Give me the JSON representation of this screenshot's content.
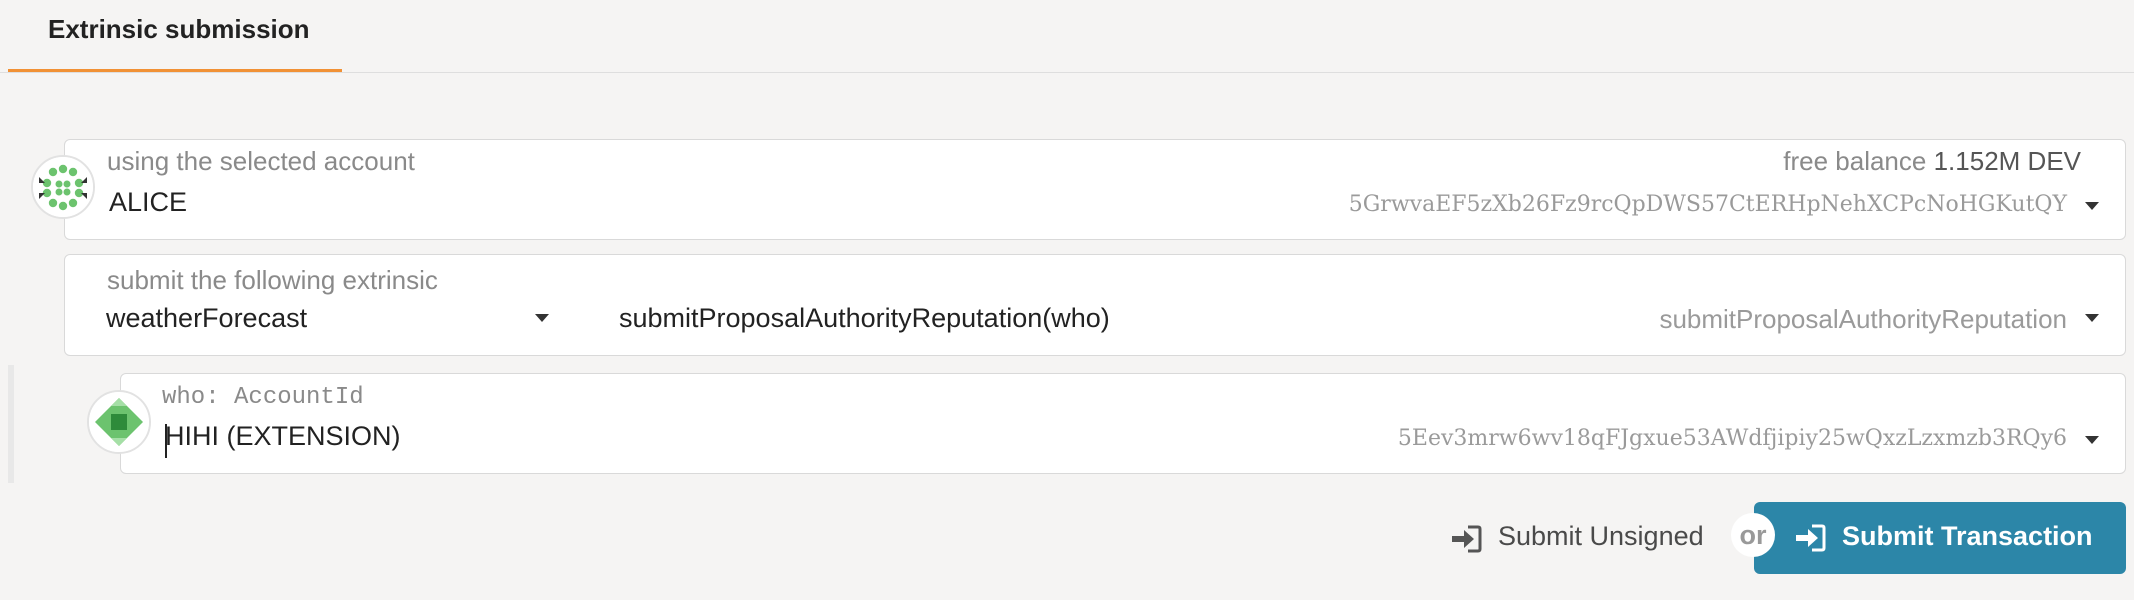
{
  "tabs": [
    {
      "label": "Extrinsic submission"
    }
  ],
  "account": {
    "label": "using the selected account",
    "name": "ALICE",
    "balance_label": "free balance",
    "balance_value": "1.152M DEV",
    "address": "5GrwvaEF5zXb26Fz9rcQpDWS57CtERHpNehXCPcNoHGKutQY"
  },
  "extrinsic": {
    "label": "submit the following extrinsic",
    "module": "weatherForecast",
    "method_signature": "submitProposalAuthorityReputation(who)",
    "method": "submitProposalAuthorityReputation"
  },
  "param": {
    "label": "who: AccountId",
    "value": "HIHI (EXTENSION)",
    "address": "5Eev3mrw6wv18qFJgxue53AWdfjipiy25wQxzLzxmzb3RQy6"
  },
  "actions": {
    "unsigned_label": "Submit Unsigned",
    "or_label": "or",
    "submit_label": "Submit Transaction"
  },
  "colors": {
    "accent_tab": "#f19135",
    "primary_button": "#2c86a8"
  }
}
